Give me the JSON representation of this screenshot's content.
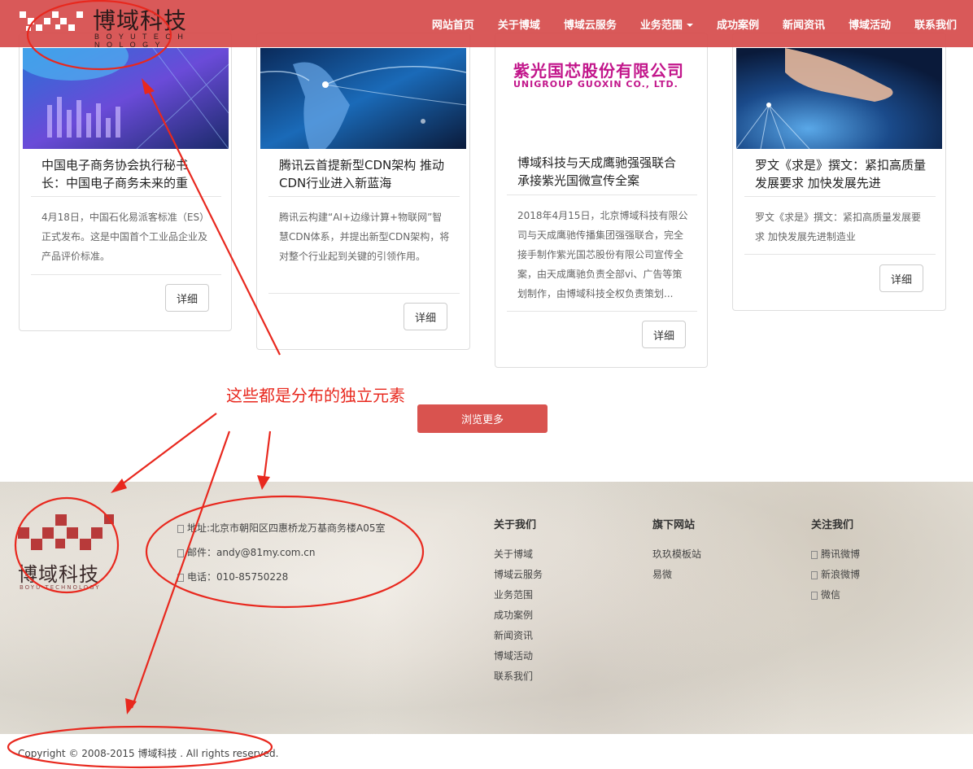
{
  "header": {
    "logo_text": "博域科技",
    "logo_sub": "B O Y U  T E C H N O L O G Y",
    "nav": [
      "网站首页",
      "关于博域",
      "博域云服务",
      "业务范围",
      "成功案例",
      "新闻资讯",
      "博域活动",
      "联系我们"
    ]
  },
  "cards": [
    {
      "title": "中国电子商务协会执行秘书长：中国电子商务未来的重",
      "desc": "4月18日，中国石化易派客标准（ES）正式发布。这是中国首个工业品企业及产品评价标准。",
      "button": "详细"
    },
    {
      "title": "腾讯云首提新型CDN架构 推动CDN行业进入新蓝海",
      "desc": "腾讯云构建“AI+边缘计算+物联网”智慧CDN体系，并提出新型CDN架构，将对整个行业起到关键的引领作用。",
      "button": "详细"
    },
    {
      "title": "博域科技与天成鹰驰强强联合承接紫光国微宣传全案",
      "desc": "2018年4月15日，北京博域科技有限公司与天成鹰驰传播集团强强联合，完全接手制作紫光国芯股份有限公司宣传全案，由天成鹰驰负责全部vi、广告等策划制作，由博域科技全权负责策划...",
      "button": "详细",
      "img_logo_cn": "紫光国芯股份有限公司",
      "img_logo_en": "UNIGROUP GUOXIN CO., LTD."
    },
    {
      "title": "罗文《求是》撰文：紧扣高质量发展要求 加快发展先进",
      "desc": "罗文《求是》撰文：紧扣高质量发展要求 加快发展先进制造业",
      "button": "详细"
    }
  ],
  "more_button": "浏览更多",
  "footer": {
    "logo_text": "博域科技",
    "logo_sub": "BOYU  TECHNOLOGY",
    "contact": {
      "address": "地址:北京市朝阳区四惠桥龙万基商务楼A05室",
      "email": "邮件：andy@81my.com.cn",
      "phone": "电话：010-85750228"
    },
    "about": {
      "title": "关于我们",
      "links": [
        "关于博域",
        "博域云服务",
        "业务范围",
        "成功案例",
        "新闻资讯",
        "博域活动",
        "联系我们"
      ]
    },
    "sites": {
      "title": "旗下网站",
      "links": [
        "玖玖模板站",
        "易微"
      ]
    },
    "follow": {
      "title": "关注我们",
      "links": [
        "腾讯微博",
        "新浪微博",
        "微信"
      ]
    }
  },
  "copyright": "Copyright © 2008-2015 博域科技 . All rights reserved.",
  "annotation": {
    "text": "这些都是分布的独立元素",
    "color": "#e8281e"
  },
  "colors": {
    "nav_bg": "#d64c4c",
    "accent": "#d9534f"
  }
}
